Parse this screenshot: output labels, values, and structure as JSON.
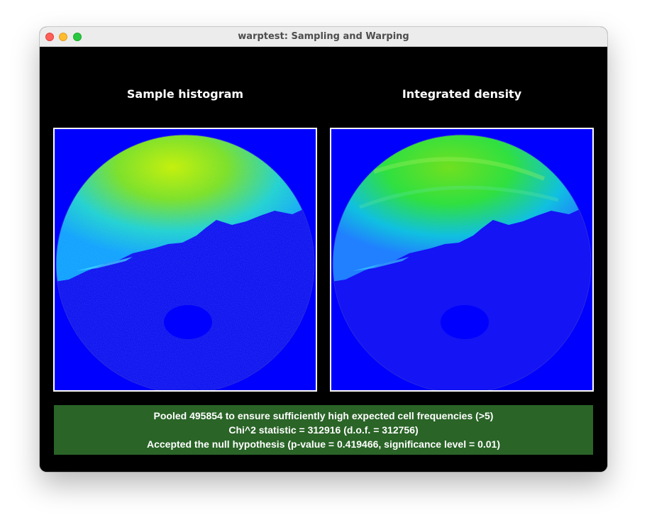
{
  "window": {
    "title": "warptest: Sampling and Warping"
  },
  "panels": {
    "left_title": "Sample histogram",
    "right_title": "Integrated density"
  },
  "stats": {
    "line1": "Pooled 495854 to ensure sufficiently high expected cell frequencies (>5)",
    "line2": "Chi^2 statistic = 312916 (d.o.f. = 312756)",
    "line3": "Accepted the null hypothesis (p-value = 0.419466, significance level = 0.01)"
  },
  "colors": {
    "background": "#000000",
    "panel_fill": "#0000ff",
    "stats_bar": "#2a6427",
    "titlebar": "#ececec"
  }
}
